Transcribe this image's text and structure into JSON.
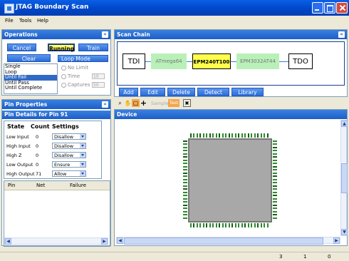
{
  "window": {
    "title": "JTAG Boundary Scan"
  },
  "menu": [
    "File",
    "Tools",
    "Help"
  ],
  "operations": {
    "title": "Operations",
    "buttons": {
      "cancel": "Cancel",
      "running": "Running",
      "train": "Train",
      "clear": "Clear"
    },
    "loop_mode_label": "Loop Mode",
    "modes": [
      "Single",
      "Loop",
      "Until Fail",
      "Until Pass",
      "Until Complete"
    ],
    "selected_mode": "Until Fail",
    "radios": [
      "No Limit",
      "Time",
      "Captures"
    ],
    "time_value": "10",
    "captures_value": "50"
  },
  "scan_chain": {
    "title": "Scan Chain",
    "tdi": "TDI",
    "tdo": "TDO",
    "devices": [
      "ATmega64",
      "EPM240T100",
      "EPM3032AT44"
    ],
    "active_device": "EPM240T100",
    "buttons": [
      "Add",
      "Edit",
      "Delete",
      "Detect",
      "Library"
    ]
  },
  "toolbar": {
    "sample": "Sample",
    "test": "Test"
  },
  "pin_properties": {
    "title": "Pin Properties",
    "details_title": "Pin Details for Pin 91",
    "headers": [
      "State",
      "Count",
      "Settings"
    ],
    "rows": [
      {
        "state": "Low Input",
        "count": "0",
        "setting": "Disallow"
      },
      {
        "state": "High Input",
        "count": "0",
        "setting": "Disallow"
      },
      {
        "state": "High Z",
        "count": "0",
        "setting": "Disallow"
      },
      {
        "state": "Low Output",
        "count": "0",
        "setting": "Ensure"
      },
      {
        "state": "High Output",
        "count": "71",
        "setting": "Allow"
      }
    ],
    "table_headers": [
      "Pin",
      "Net",
      "Failure"
    ]
  },
  "device": {
    "title": "Device"
  },
  "status": [
    "3",
    "1",
    "0"
  ],
  "colors": {
    "accent": "#2c6cd6",
    "active_chip": "#ffff4c",
    "inactive_chip": "#b8f0b8"
  }
}
